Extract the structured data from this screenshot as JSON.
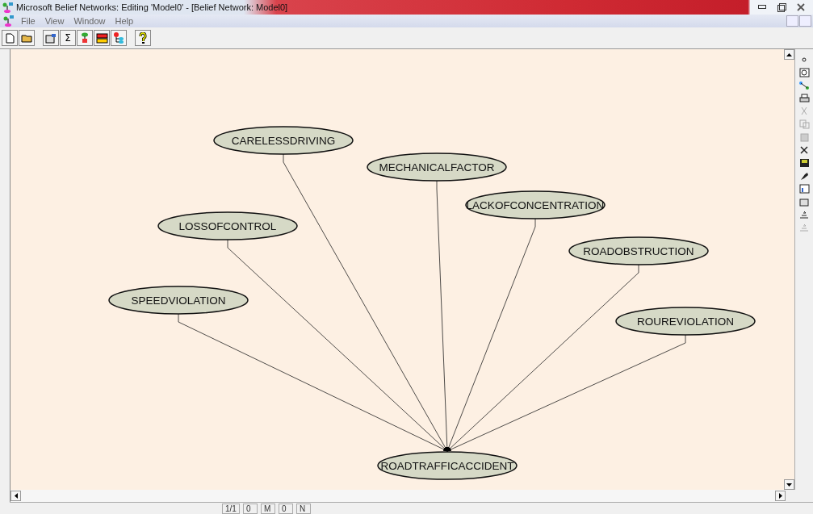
{
  "window": {
    "title": "Microsoft Belief Networks: Editing 'Model0' - [Belief Network:  Model0]"
  },
  "menu": [
    "File",
    "View",
    "Window",
    "Help"
  ],
  "toolbar": {
    "sum_button": "Σ"
  },
  "network": {
    "nodes": [
      {
        "label": "CARELESSDRIVING",
        "kind": "cause"
      },
      {
        "label": "MECHANICALFACTOR",
        "kind": "cause"
      },
      {
        "label": "LACKOFCONCENTRATION",
        "kind": "cause"
      },
      {
        "label": "LOSSOFCONTROL",
        "kind": "cause"
      },
      {
        "label": "ROADOBSTRUCTION",
        "kind": "cause"
      },
      {
        "label": "SPEEDVIOLATION",
        "kind": "cause"
      },
      {
        "label": "ROUREVIOLATION",
        "kind": "cause"
      },
      {
        "label": "ROADTRAFFICACCIDENT",
        "kind": "effect"
      }
    ]
  },
  "status_bar": [
    "1/1",
    "0",
    "M",
    "0",
    "N"
  ]
}
